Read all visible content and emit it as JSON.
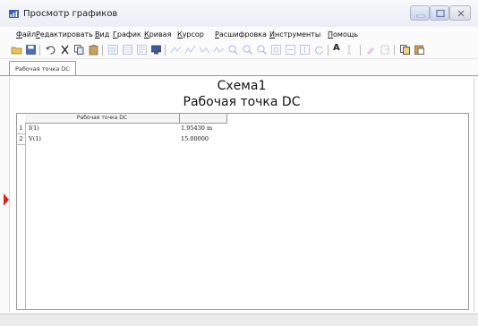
{
  "window": {
    "title": "Просмотр графиков",
    "icon": "chart-app-icon"
  },
  "menu": {
    "items": [
      {
        "label": "Файл",
        "u": "Ф",
        "rest": "айл"
      },
      {
        "label": "Редактировать",
        "u": "Р",
        "rest": "едактировать"
      },
      {
        "label": "Вид",
        "u": "В",
        "rest": "ид"
      },
      {
        "label": "График",
        "u": "Г",
        "rest": "рафик"
      },
      {
        "label": "Кривая",
        "u": "К",
        "rest": "ривая"
      },
      {
        "label": "Курсор",
        "u": "К",
        "rest": "урсор"
      },
      {
        "label": "Расшифровка",
        "u": "Р",
        "rest": "асшифровка"
      },
      {
        "label": "Инструменты",
        "u": "И",
        "rest": "нструменты"
      },
      {
        "label": "Помощь",
        "u": "П",
        "rest": "омощь"
      }
    ]
  },
  "toolbar": {
    "font_button_label": "A"
  },
  "tab": {
    "label": "Рабочая точка DC"
  },
  "document": {
    "title": "Схема1",
    "subtitle": "Рабочая точка DC"
  },
  "table": {
    "header": "Рабочая точка DC",
    "rows": [
      {
        "num": "1",
        "name": "I(1)",
        "value": "1.95430 m"
      },
      {
        "num": "2",
        "name": "V(1)",
        "value": "15.00000"
      }
    ]
  },
  "colors": {
    "marker": "#e0221b",
    "titlebar": "#eceef3"
  }
}
